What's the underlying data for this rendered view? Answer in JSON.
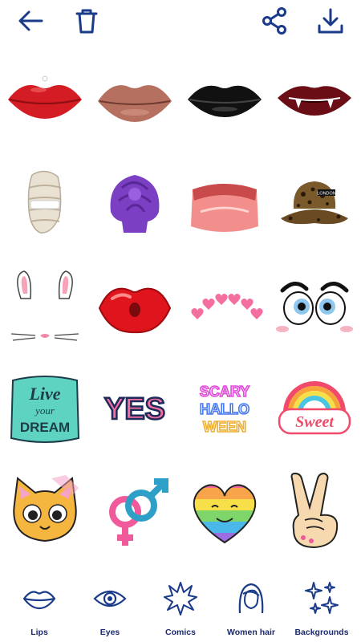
{
  "toolbar": {
    "icons": [
      "back-arrow-icon",
      "trash-icon",
      "share-icon",
      "download-icon"
    ],
    "icon_color": "#1a3a8a"
  },
  "stickers": [
    {
      "name": "red-lips",
      "category": "Lips"
    },
    {
      "name": "nude-lips",
      "category": "Lips"
    },
    {
      "name": "black-lips",
      "category": "Lips"
    },
    {
      "name": "vampire-lips",
      "category": "Lips"
    },
    {
      "name": "bandage-mask",
      "category": "Women hair"
    },
    {
      "name": "purple-turban",
      "category": "Women hair"
    },
    {
      "name": "pink-visor",
      "category": "Women hair"
    },
    {
      "name": "leopard-bucket-hat",
      "category": "Women hair",
      "text": "LONDON"
    },
    {
      "name": "bunny-face",
      "category": "Comics"
    },
    {
      "name": "kiss-lips",
      "category": "Lips"
    },
    {
      "name": "hearts-crown",
      "category": "Comics"
    },
    {
      "name": "cartoon-eyes",
      "category": "Eyes"
    },
    {
      "name": "live-your-dream",
      "category": "Comics",
      "text": [
        "Live",
        "your",
        "DREAM"
      ]
    },
    {
      "name": "yes-sticker",
      "category": "Comics",
      "text": "YES"
    },
    {
      "name": "scary-halloween-neon",
      "category": "Comics",
      "text": [
        "SCARY",
        "HALLO",
        "WEEN"
      ]
    },
    {
      "name": "sweet-rainbow",
      "category": "Comics",
      "text": "Sweet"
    },
    {
      "name": "kitty-face",
      "category": "Comics"
    },
    {
      "name": "gender-symbols",
      "category": "Comics"
    },
    {
      "name": "rainbow-heart",
      "category": "Comics"
    },
    {
      "name": "peace-hand",
      "category": "Comics"
    }
  ],
  "nav": {
    "items": [
      {
        "label": "Lips",
        "icon": "lips-icon"
      },
      {
        "label": "Eyes",
        "icon": "eye-icon"
      },
      {
        "label": "Comics",
        "icon": "comic-burst-icon"
      },
      {
        "label": "Women hair",
        "icon": "woman-hair-icon"
      },
      {
        "label": "Backgrounds",
        "icon": "sparkles-icon"
      }
    ],
    "label_color": "#1a2a6c"
  }
}
